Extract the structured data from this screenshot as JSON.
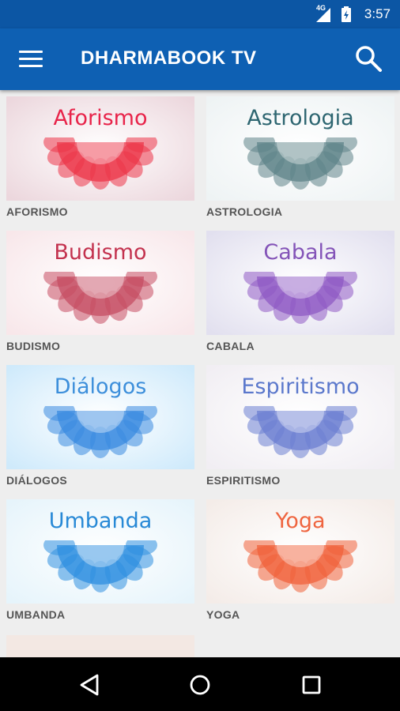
{
  "status": {
    "network": "4G",
    "time": "3:57"
  },
  "app": {
    "title": "DHARMABOOK TV"
  },
  "icons": {
    "menu": "menu-icon",
    "search": "search-icon",
    "back": "back-icon",
    "home": "home-icon",
    "recents": "recents-icon"
  },
  "categories": [
    {
      "word": "Aforismo",
      "label": "AFORISMO",
      "bg": "#ecd7dd",
      "text": "#e8244a",
      "mandala": "#ec3548"
    },
    {
      "word": "Astrologia",
      "label": "ASTROLOGIA",
      "bg": "#eef3f4",
      "text": "#2e6671",
      "mandala": "#5f8489"
    },
    {
      "word": "Budismo",
      "label": "BUDISMO",
      "bg": "#f8e7ea",
      "text": "#c3324e",
      "mandala": "#c64d63"
    },
    {
      "word": "Cabala",
      "label": "CABALA",
      "bg": "#e2e0ef",
      "text": "#8454b8",
      "mandala": "#8f5ac4"
    },
    {
      "word": "Diálogos",
      "label": "DIÁLOGOS",
      "bg": "#cfeafb",
      "text": "#3d8fdb",
      "mandala": "#3a8be0"
    },
    {
      "word": "Espiritismo",
      "label": "ESPIRITISMO",
      "bg": "#f1eef3",
      "text": "#5b78cc",
      "mandala": "#6c7fd2"
    },
    {
      "word": "Umbanda",
      "label": "UMBANDA",
      "bg": "#e6f4fb",
      "text": "#2889d6",
      "mandala": "#2f8fe0"
    },
    {
      "word": "Yoga",
      "label": "YOGA",
      "bg": "#f4ece8",
      "text": "#ef6540",
      "mandala": "#f0623b"
    }
  ]
}
